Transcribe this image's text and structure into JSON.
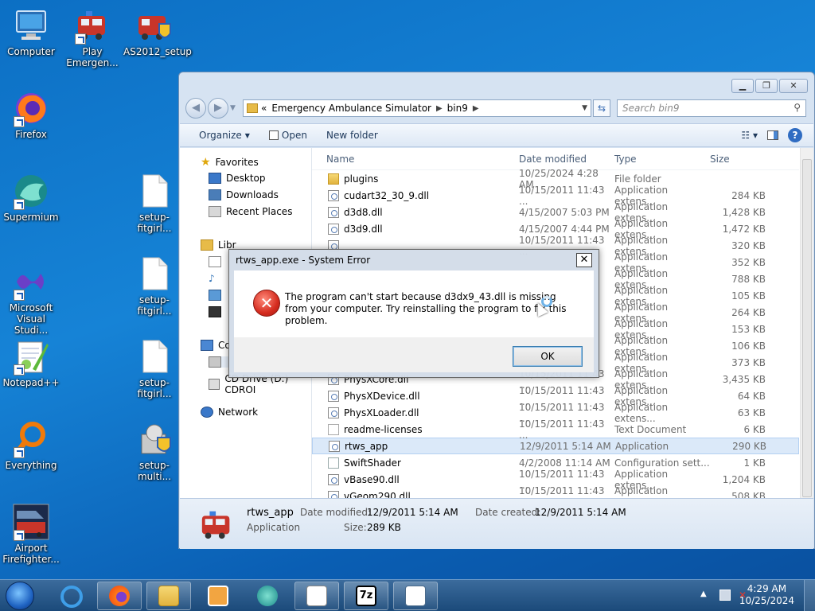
{
  "desktop": {
    "icons": [
      {
        "label": "Computer"
      },
      {
        "label": "Play Emergen..."
      },
      {
        "label": "AS2012_setup"
      },
      {
        "label": "Firefox"
      },
      {
        "label": "Supermium"
      },
      {
        "label": "setup-fitgirl..."
      },
      {
        "label": "Microsoft Visual Studi..."
      },
      {
        "label": "setup-fitgirl..."
      },
      {
        "label": "Notepad++"
      },
      {
        "label": "setup-fitgirl..."
      },
      {
        "label": "Everything"
      },
      {
        "label": "setup-multi..."
      },
      {
        "label": "Airport Firefighter..."
      }
    ]
  },
  "explorer": {
    "breadcrumb": [
      "Emergency Ambulance Simulator",
      "bin9"
    ],
    "address_prefix": "«",
    "search_placeholder": "Search bin9",
    "toolbar": {
      "organize": "Organize",
      "open": "Open",
      "new_folder": "New folder"
    },
    "nav": {
      "favorites": "Favorites",
      "desktop": "Desktop",
      "downloads": "Downloads",
      "recent": "Recent Places",
      "libraries": "Libr",
      "computer": "Co",
      "cd_drive": "CD Drive (D:) CDROI",
      "network": "Network"
    },
    "columns": {
      "name": "Name",
      "date": "Date modified",
      "type": "Type",
      "size": "Size"
    },
    "files": [
      {
        "name": "plugins",
        "date": "10/25/2024 4:28 AM",
        "type": "File folder",
        "size": "",
        "icon": "folder"
      },
      {
        "name": "cudart32_30_9.dll",
        "date": "10/15/2011 11:43 ...",
        "type": "Application extens...",
        "size": "284 KB",
        "icon": "app"
      },
      {
        "name": "d3d8.dll",
        "date": "4/15/2007 5:03 PM",
        "type": "Application extens...",
        "size": "1,428 KB",
        "icon": "app"
      },
      {
        "name": "d3d9.dll",
        "date": "4/15/2007 4:44 PM",
        "type": "Application extens...",
        "size": "1,472 KB",
        "icon": "app"
      },
      {
        "name": "",
        "date": "10/15/2011 11:43 ...",
        "type": "Application extens...",
        "size": "320 KB",
        "icon": "app"
      },
      {
        "name": "",
        "date": "",
        "type": "Application extens...",
        "size": "352 KB",
        "icon": "app"
      },
      {
        "name": "",
        "date": "",
        "type": "Application extens...",
        "size": "788 KB",
        "icon": "app"
      },
      {
        "name": "",
        "date": "AM",
        "type": "Application extens...",
        "size": "105 KB",
        "icon": "app"
      },
      {
        "name": "",
        "date": "",
        "type": "Application extens...",
        "size": "264 KB",
        "icon": "app"
      },
      {
        "name": "",
        "date": "",
        "type": "Application extens...",
        "size": "153 KB",
        "icon": "app"
      },
      {
        "name": "",
        "date": "",
        "type": "Application extens...",
        "size": "106 KB",
        "icon": "app"
      },
      {
        "name": "",
        "date": "",
        "type": "Application extens...",
        "size": "373 KB",
        "icon": "app"
      },
      {
        "name": "PhysXCore.dll",
        "date": "10/15/2011 11:43 ...",
        "type": "Application extens...",
        "size": "3,435 KB",
        "icon": "app"
      },
      {
        "name": "PhysXDevice.dll",
        "date": "10/15/2011 11:43 ...",
        "type": "Application extens...",
        "size": "64 KB",
        "icon": "app"
      },
      {
        "name": "PhysXLoader.dll",
        "date": "10/15/2011 11:43 ...",
        "type": "Application extens...",
        "size": "63 KB",
        "icon": "app"
      },
      {
        "name": "readme-licenses",
        "date": "10/15/2011 11:43 ...",
        "type": "Text Document",
        "size": "6 KB",
        "icon": "txt"
      },
      {
        "name": "rtws_app",
        "date": "12/9/2011 5:14 AM",
        "type": "Application",
        "size": "290 KB",
        "icon": "exe"
      },
      {
        "name": "SwiftShader",
        "date": "4/2/2008 11:14 AM",
        "type": "Configuration sett...",
        "size": "1 KB",
        "icon": "cfg"
      },
      {
        "name": "vBase90.dll",
        "date": "10/15/2011 11:43 ...",
        "type": "Application extens...",
        "size": "1,204 KB",
        "icon": "app"
      },
      {
        "name": "vGeom290.dll",
        "date": "10/15/2011 11:43 ...",
        "type": "Application extens...",
        "size": "508 KB",
        "icon": "app"
      }
    ],
    "selected_row": 16,
    "details": {
      "name": "rtws_app",
      "kind": "Application",
      "modified_label": "Date modified:",
      "modified_value": "12/9/2011 5:14 AM",
      "created_label": "Date created:",
      "created_value": "12/9/2011 5:14 AM",
      "size_label": "Size:",
      "size_value": "289 KB"
    }
  },
  "dialog": {
    "title": "rtws_app.exe - System Error",
    "message": "The program can't start because d3dx9_43.dll is missing from your computer. Try reinstalling the program to fix this problem.",
    "ok": "OK",
    "close": "✕"
  },
  "taskbar": {
    "time": "4:29 AM",
    "date": "10/25/2024",
    "items": [
      "internet-explorer",
      "firefox",
      "file-explorer",
      "media-player",
      "supermium",
      "notepad-plus-plus",
      "7zip",
      "control-panel"
    ]
  }
}
